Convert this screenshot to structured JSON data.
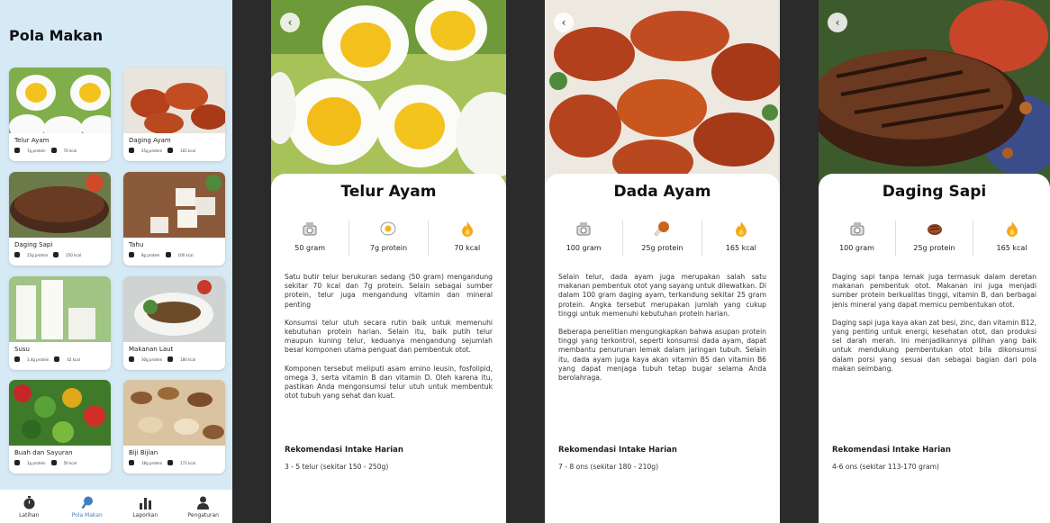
{
  "list_screen": {
    "title": "Pola Makan",
    "cards": [
      {
        "name": "Telur Ayam",
        "protein": "7g protein",
        "kcal": "70 kcal"
      },
      {
        "name": "Daging Ayam",
        "protein": "25g protein",
        "kcal": "165 kcal"
      },
      {
        "name": "Daging Sapi",
        "protein": "25g protein",
        "kcal": "250 kcal"
      },
      {
        "name": "Tahu",
        "protein": "8g protein",
        "kcal": "100 kcal"
      },
      {
        "name": "Susu",
        "protein": "3,4g protein",
        "kcal": "42 kcal"
      },
      {
        "name": "Makanan Laut",
        "protein": "30g protein",
        "kcal": "180 kcal"
      },
      {
        "name": "Buah dan Sayuran",
        "protein": "1g protein",
        "kcal": "50 kcal"
      },
      {
        "name": "Biji Bijian",
        "protein": "18g protein",
        "kcal": "172 kcal"
      }
    ],
    "nav": [
      {
        "label": "Latihan",
        "icon": "stopwatch-icon"
      },
      {
        "label": "Pola Makan",
        "icon": "drumstick-icon"
      },
      {
        "label": "Laporkan",
        "icon": "bar-chart-icon"
      },
      {
        "label": "Pengaturan",
        "icon": "user-icon"
      }
    ],
    "active_nav": "Pola Makan"
  },
  "details": [
    {
      "title": "Telur Ayam",
      "weight": "50 gram",
      "protein": "7g protein",
      "kcal": "70 kcal",
      "paragraphs": [
        "Satu butir telur berukuran sedang (50 gram) mengandung sekitar 70 kcal dan 7g protein. Selain sebagai sumber protein, telur juga mengandung vitamin dan mineral penting",
        "Konsumsi telur utuh secara rutin baik untuk memenuhi kebutuhan protein harian. Selain itu, baik putih telur maupun kuning telur, keduanya mengandung sejumlah besar komponen utama penguat dan pembentuk otot.",
        "Komponen tersebut meliputi asam amino leusin, fosfolipid, omega 3, serta vitamin B dan vitamin D. Oleh karena itu, pastikan Anda mengonsumsi telur utuh untuk membentuk otot tubuh yang sehat dan kuat."
      ],
      "rec_title": "Rekomendasi Intake Harian",
      "rec_text": "3 - 5 telur (sekitar 150 - 250g)"
    },
    {
      "title": "Dada Ayam",
      "weight": "100 gram",
      "protein": "25g protein",
      "kcal": "165 kcal",
      "paragraphs": [
        "Selain telur, dada ayam juga merupakan salah satu makanan pembentuk otot yang sayang untuk dilewatkan. Di dalam 100 gram daging ayam, terkandung sekitar 25 gram protein. Angka tersebut merupakan jumlah yang cukup tinggi untuk memenuhi kebutuhan protein harian.",
        "Beberapa penelitian mengungkapkan bahwa asupan protein tinggi yang terkontrol, seperti konsumsi dada ayam, dapat membantu penurunan lemak dalam jaringan tubuh. Selain itu, dada ayam juga kaya akan vitamin B5 dan vitamin B6 yang dapat menjaga tubuh tetap bugar selama Anda berolahraga."
      ],
      "rec_title": "Rekomendasi Intake Harian",
      "rec_text": "7 - 8 ons (sekitar 180 - 210g)"
    },
    {
      "title": "Daging Sapi",
      "weight": "100 gram",
      "protein": "25g protein",
      "kcal": "165 kcal",
      "paragraphs": [
        "Daging sapi tanpa lemak juga termasuk dalam deretan makanan pembentuk otot. Makanan ini juga menjadi sumber protein berkualitas tinggi, vitamin B, dan berbagai jenis mineral yang dapat memicu pembentukan otot.",
        "Daging sapi juga kaya akan zat besi, zinc, dan vitamin B12, yang penting untuk energi, kesehatan otot, dan produksi sel darah merah. Ini menjadikannya pilihan yang baik untuk mendukung pembentukan otot bila dikonsumsi dalam porsi yang sesuai dan sebagai bagian dari pola makan seimbang."
      ],
      "rec_title": "Rekomendasi Intake Harian",
      "rec_text": "4-6 ons (sekitar 113-170 gram)"
    }
  ],
  "icons": {
    "back": "chevron-left-icon",
    "weight": "scale-icon",
    "protein_egg": "fried-egg-icon",
    "protein_chicken": "drumstick-icon",
    "protein_beef": "steak-icon",
    "kcal": "flame-icon"
  },
  "colors": {
    "list_bg": "#d6eaf5",
    "nav_active": "#3f7fbf",
    "flame": "#f4a91c"
  }
}
